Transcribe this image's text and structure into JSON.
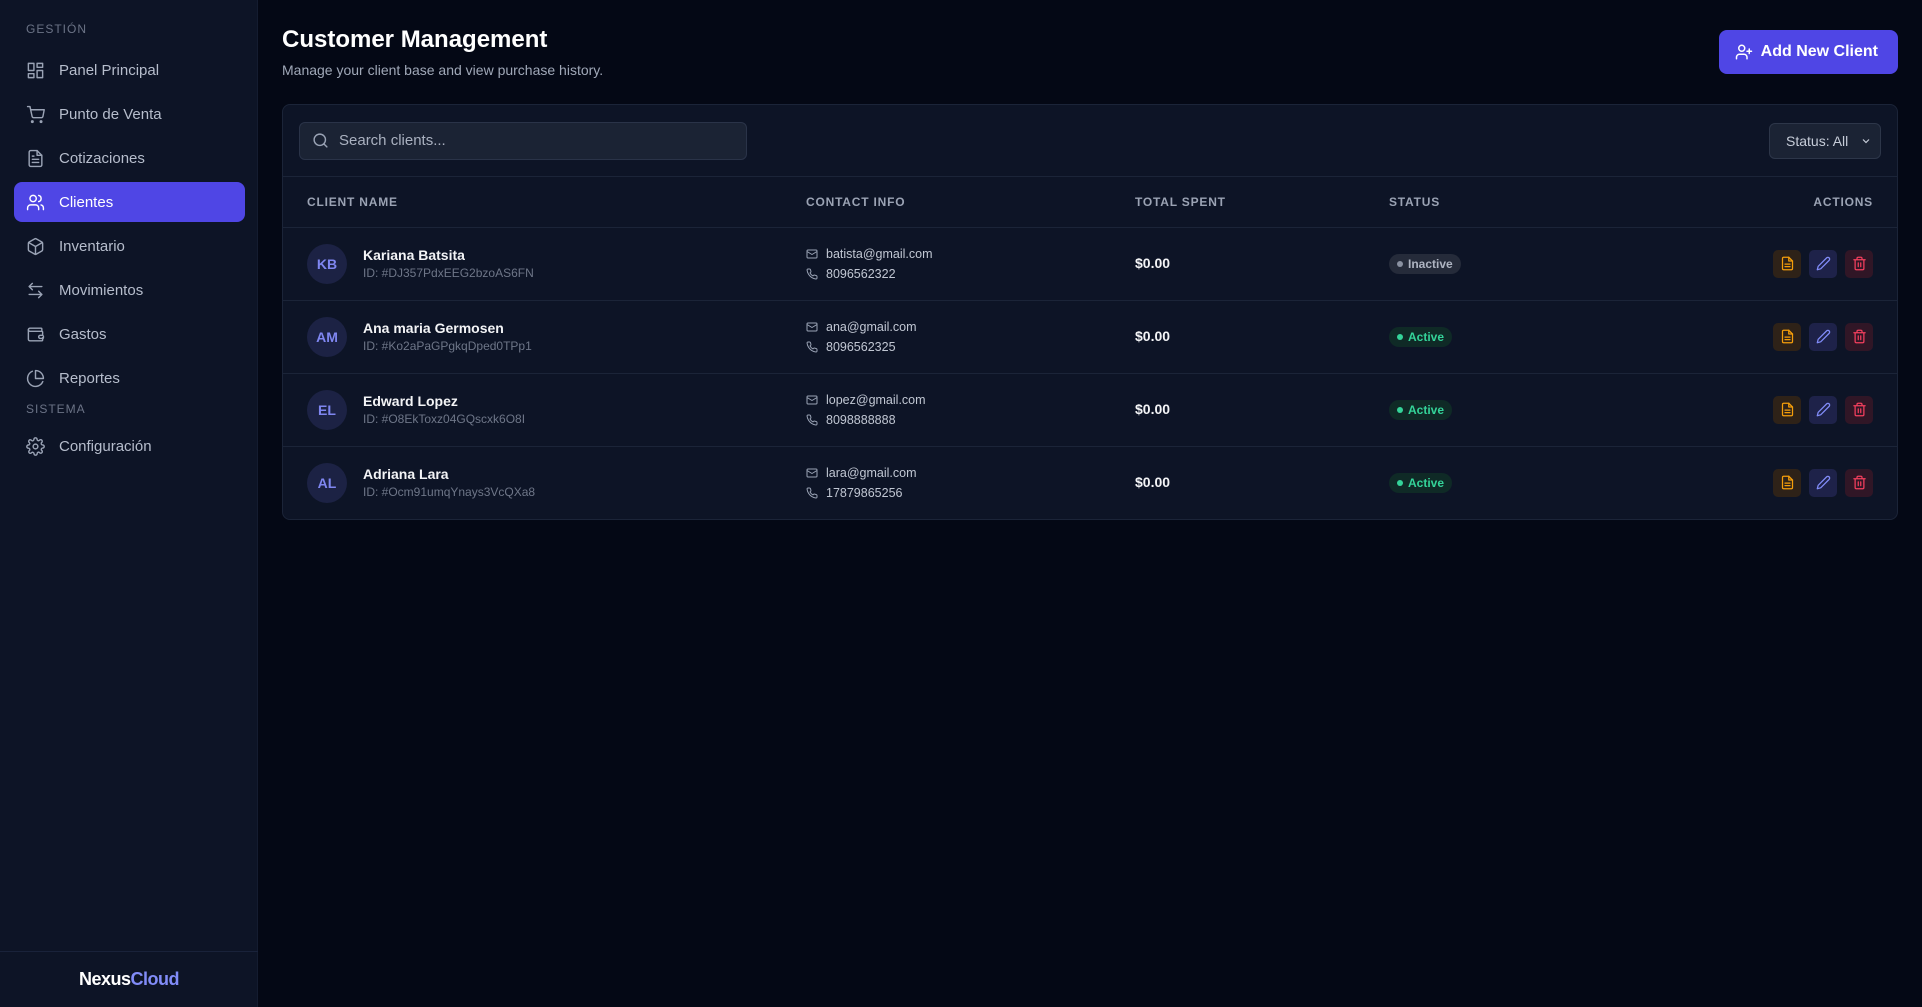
{
  "sidebar": {
    "section_main": "GESTIÓN",
    "section_system": "SISTEMA",
    "items": [
      {
        "label": "Panel Principal",
        "icon": "grid-icon"
      },
      {
        "label": "Punto de Venta",
        "icon": "cart-icon"
      },
      {
        "label": "Cotizaciones",
        "icon": "file-icon"
      },
      {
        "label": "Clientes",
        "icon": "users-icon",
        "active": true
      },
      {
        "label": "Inventario",
        "icon": "box-icon"
      },
      {
        "label": "Movimientos",
        "icon": "arrows-icon"
      },
      {
        "label": "Gastos",
        "icon": "wallet-icon"
      },
      {
        "label": "Reportes",
        "icon": "pie-icon"
      }
    ],
    "system_items": [
      {
        "label": "Configuración",
        "icon": "gear-icon"
      }
    ],
    "brand_part1": "Nexus",
    "brand_part2": "Cloud"
  },
  "header": {
    "title": "Customer Management",
    "subtitle": "Manage your client base and view purchase history.",
    "add_button": "Add New Client"
  },
  "toolbar": {
    "search_placeholder": "Search clients...",
    "status_filter": "Status: All"
  },
  "table": {
    "columns": [
      "CLIENT NAME",
      "CONTACT INFO",
      "TOTAL SPENT",
      "STATUS",
      "ACTIONS"
    ],
    "rows": [
      {
        "initials": "KB",
        "name": "Kariana Batsita",
        "id": "ID: #DJ357PdxEEG2bzoAS6FN",
        "email": "batista@gmail.com",
        "phone": "8096562322",
        "spent": "$0.00",
        "status": "Inactive"
      },
      {
        "initials": "AM",
        "name": "Ana maria Germosen",
        "id": "ID: #Ko2aPaGPgkqDped0TPp1",
        "email": "ana@gmail.com",
        "phone": "8096562325",
        "spent": "$0.00",
        "status": "Active"
      },
      {
        "initials": "EL",
        "name": "Edward Lopez",
        "id": "ID: #O8EkToxz04GQscxk6O8I",
        "email": "lopez@gmail.com",
        "phone": "8098888888",
        "spent": "$0.00",
        "status": "Active"
      },
      {
        "initials": "AL",
        "name": "Adriana Lara",
        "id": "ID: #Ocm91umqYnays3VcQXa8",
        "email": "lara@gmail.com",
        "phone": "17879865256",
        "spent": "$0.00",
        "status": "Active"
      }
    ]
  },
  "colors": {
    "accent": "#4f46e5",
    "background": "#040815",
    "panel": "#0d1426",
    "active_status": "#34d399",
    "doc_action": "#f59e0b",
    "edit_action": "#818cf8",
    "delete_action": "#f43f5e"
  }
}
